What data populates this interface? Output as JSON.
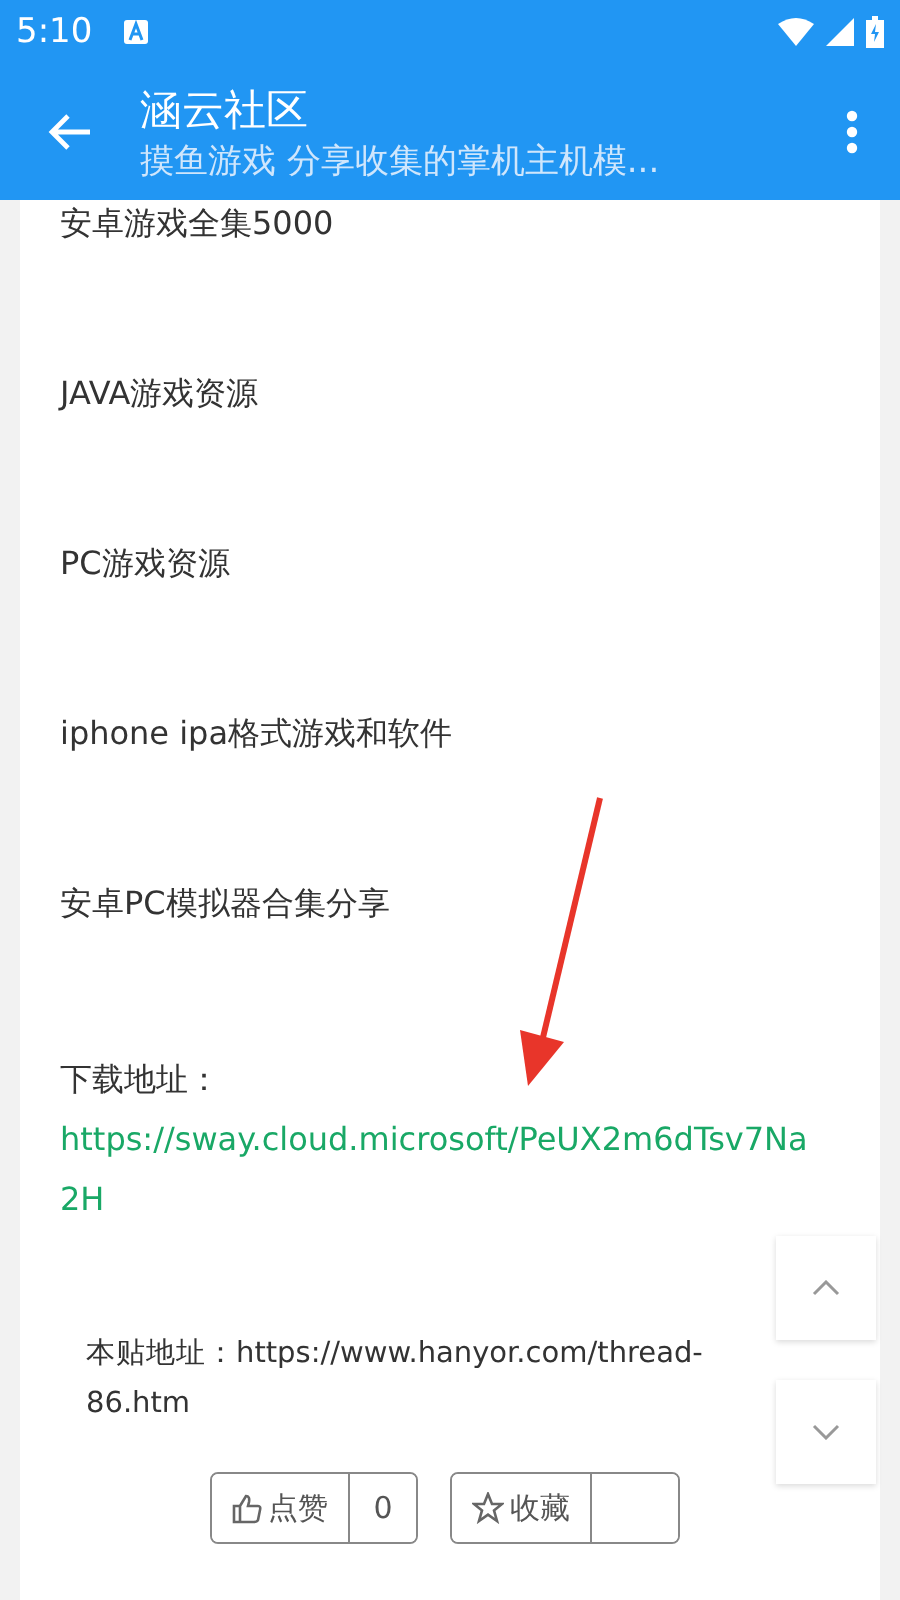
{
  "status_bar": {
    "time": "5:10"
  },
  "toolbar": {
    "title": "涵云社区",
    "subtitle": "摸鱼游戏 分享收集的掌机主机模..."
  },
  "post": {
    "lines": [
      {
        "kind": "text",
        "text": "安卓游戏全集5000"
      },
      {
        "kind": "text",
        "text": "JAVA游戏资源"
      },
      {
        "kind": "text",
        "text": "PC游戏资源"
      },
      {
        "kind": "text",
        "text": "iphone ipa格式游戏和软件"
      },
      {
        "kind": "text",
        "text": "安卓PC模拟器合集分享"
      }
    ],
    "download_label": "下载地址：",
    "download_link": "https://sway.cloud.microsoft/PeUX2m6dTsv7Na2H",
    "source": "本贴地址：https://www.hanyor.com/thread-86.htm",
    "like": {
      "label": "点赞",
      "count": "0"
    },
    "favorite": {
      "label": "收藏"
    }
  }
}
